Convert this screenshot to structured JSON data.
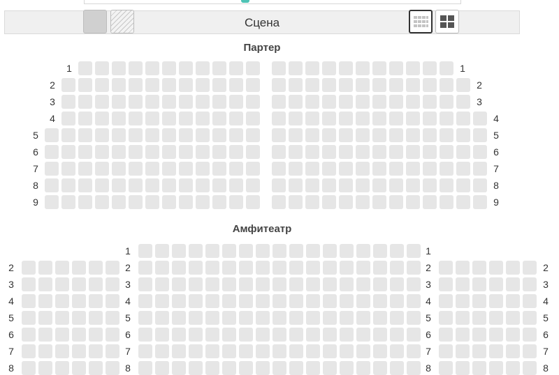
{
  "stage": {
    "label": "Сцена"
  },
  "legend": {
    "taken": "taken-seat-sample",
    "unavailable": "unavailable-seat-sample"
  },
  "view_toggle": {
    "small_icon": "grid-small-icon",
    "large_icon": "grid-large-icon",
    "selected": "small"
  },
  "sections": [
    {
      "id": "parterre",
      "title": "Партер",
      "blocks": [
        {
          "side": "left",
          "rows": [
            {
              "row": "1",
              "seats": 11
            },
            {
              "row": "2",
              "seats": 12
            },
            {
              "row": "3",
              "seats": 12
            },
            {
              "row": "4",
              "seats": 12
            },
            {
              "row": "5",
              "seats": 13
            },
            {
              "row": "6",
              "seats": 13
            },
            {
              "row": "7",
              "seats": 13
            },
            {
              "row": "8",
              "seats": 13
            },
            {
              "row": "9",
              "seats": 13
            }
          ]
        },
        {
          "side": "right",
          "rows": [
            {
              "row": "1",
              "seats": 11
            },
            {
              "row": "2",
              "seats": 12
            },
            {
              "row": "3",
              "seats": 12
            },
            {
              "row": "4",
              "seats": 13
            },
            {
              "row": "5",
              "seats": 13
            },
            {
              "row": "6",
              "seats": 13
            },
            {
              "row": "7",
              "seats": 13
            },
            {
              "row": "8",
              "seats": 13
            },
            {
              "row": "9",
              "seats": 13
            }
          ]
        }
      ]
    },
    {
      "id": "amphitheatre",
      "title": "Амфитеатр",
      "blocks": [
        {
          "side": "left",
          "rows": [
            {
              "row": "2",
              "seats": 6
            },
            {
              "row": "3",
              "seats": 6
            },
            {
              "row": "4",
              "seats": 6
            },
            {
              "row": "5",
              "seats": 6
            },
            {
              "row": "6",
              "seats": 6
            },
            {
              "row": "7",
              "seats": 6
            },
            {
              "row": "8",
              "seats": 6
            }
          ]
        },
        {
          "side": "center",
          "rows": [
            {
              "row": "1",
              "seats": 17
            },
            {
              "row": "2",
              "seats": 17
            },
            {
              "row": "3",
              "seats": 17
            },
            {
              "row": "4",
              "seats": 17
            },
            {
              "row": "5",
              "seats": 17
            },
            {
              "row": "6",
              "seats": 17
            },
            {
              "row": "7",
              "seats": 17
            },
            {
              "row": "8",
              "seats": 17
            }
          ]
        },
        {
          "side": "right",
          "rows": [
            {
              "row": "2",
              "seats": 6
            },
            {
              "row": "3",
              "seats": 6
            },
            {
              "row": "4",
              "seats": 6
            },
            {
              "row": "5",
              "seats": 6
            },
            {
              "row": "6",
              "seats": 6
            },
            {
              "row": "7",
              "seats": 6
            },
            {
              "row": "8",
              "seats": 6
            }
          ]
        }
      ]
    }
  ]
}
